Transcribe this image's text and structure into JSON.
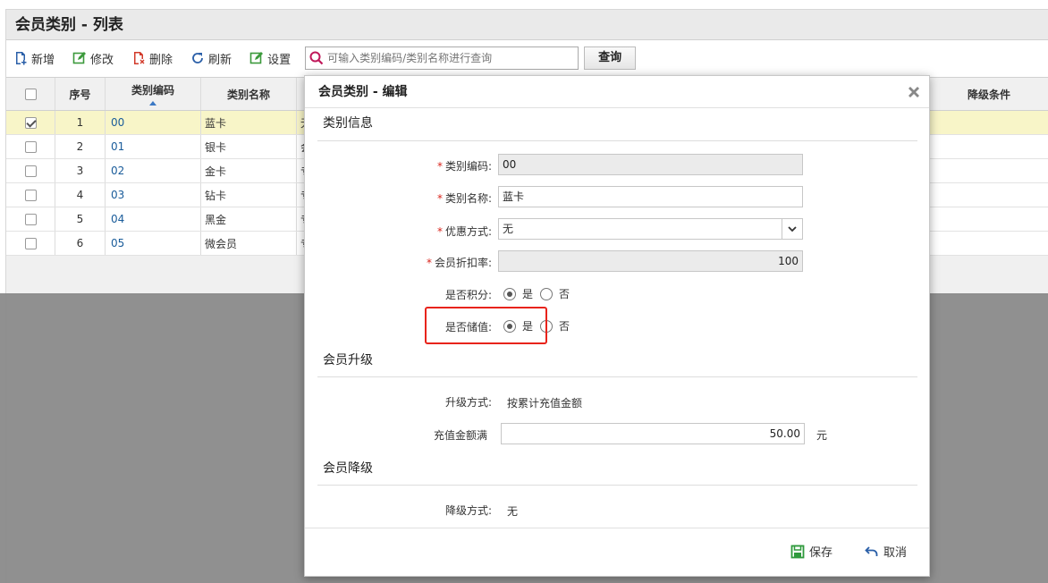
{
  "page": {
    "title": "会员类别 - 列表"
  },
  "toolbar": {
    "add_label": "新增",
    "edit_label": "修改",
    "delete_label": "删除",
    "refresh_label": "刷新",
    "settings_label": "设置",
    "search_placeholder": "可输入类别编码/类别名称进行查询",
    "search_button": "查询"
  },
  "grid": {
    "columns": {
      "no": "序号",
      "code": "类别编码",
      "name": "类别名称",
      "downgrade": "降级条件"
    },
    "rows": [
      {
        "no": "1",
        "code": "00",
        "name": "蓝卡",
        "rest": "无",
        "checked": true
      },
      {
        "no": "2",
        "code": "01",
        "name": "银卡",
        "rest": "会",
        "checked": false
      },
      {
        "no": "3",
        "code": "02",
        "name": "金卡",
        "rest": "专",
        "checked": false
      },
      {
        "no": "4",
        "code": "03",
        "name": "钻卡",
        "rest": "专",
        "checked": false
      },
      {
        "no": "5",
        "code": "04",
        "name": "黑金",
        "rest": "专",
        "checked": false
      },
      {
        "no": "6",
        "code": "05",
        "name": "微会员",
        "rest": "专",
        "checked": false
      }
    ]
  },
  "modal": {
    "title": "会员类别 - 编辑",
    "section_info": "类别信息",
    "fields": {
      "code_label": "类别编码:",
      "code_value": "00",
      "name_label": "类别名称:",
      "name_value": "蓝卡",
      "discount_mode_label": "优惠方式:",
      "discount_mode_value": "无",
      "discount_rate_label": "会员折扣率:",
      "discount_rate_value": "100",
      "points_label": "是否积分:",
      "points_yes": "是",
      "points_no": "否",
      "stored_label": "是否储值:",
      "stored_yes": "是",
      "stored_no": "否"
    },
    "section_upgrade": "会员升级",
    "upgrade": {
      "mode_label": "升级方式:",
      "mode_value": "按累计充值金额",
      "amount_label": "充值金额满",
      "amount_value": "50.00",
      "unit": "元"
    },
    "section_downgrade": "会员降级",
    "downgrade": {
      "mode_label": "降级方式:",
      "mode_value": "无"
    },
    "save_label": "保存",
    "cancel_label": "取消"
  },
  "colors": {
    "required": "#d9251c",
    "highlight": "#e8231b",
    "selected_row": "#f8f5c8",
    "code_link": "#1a5c9a"
  }
}
